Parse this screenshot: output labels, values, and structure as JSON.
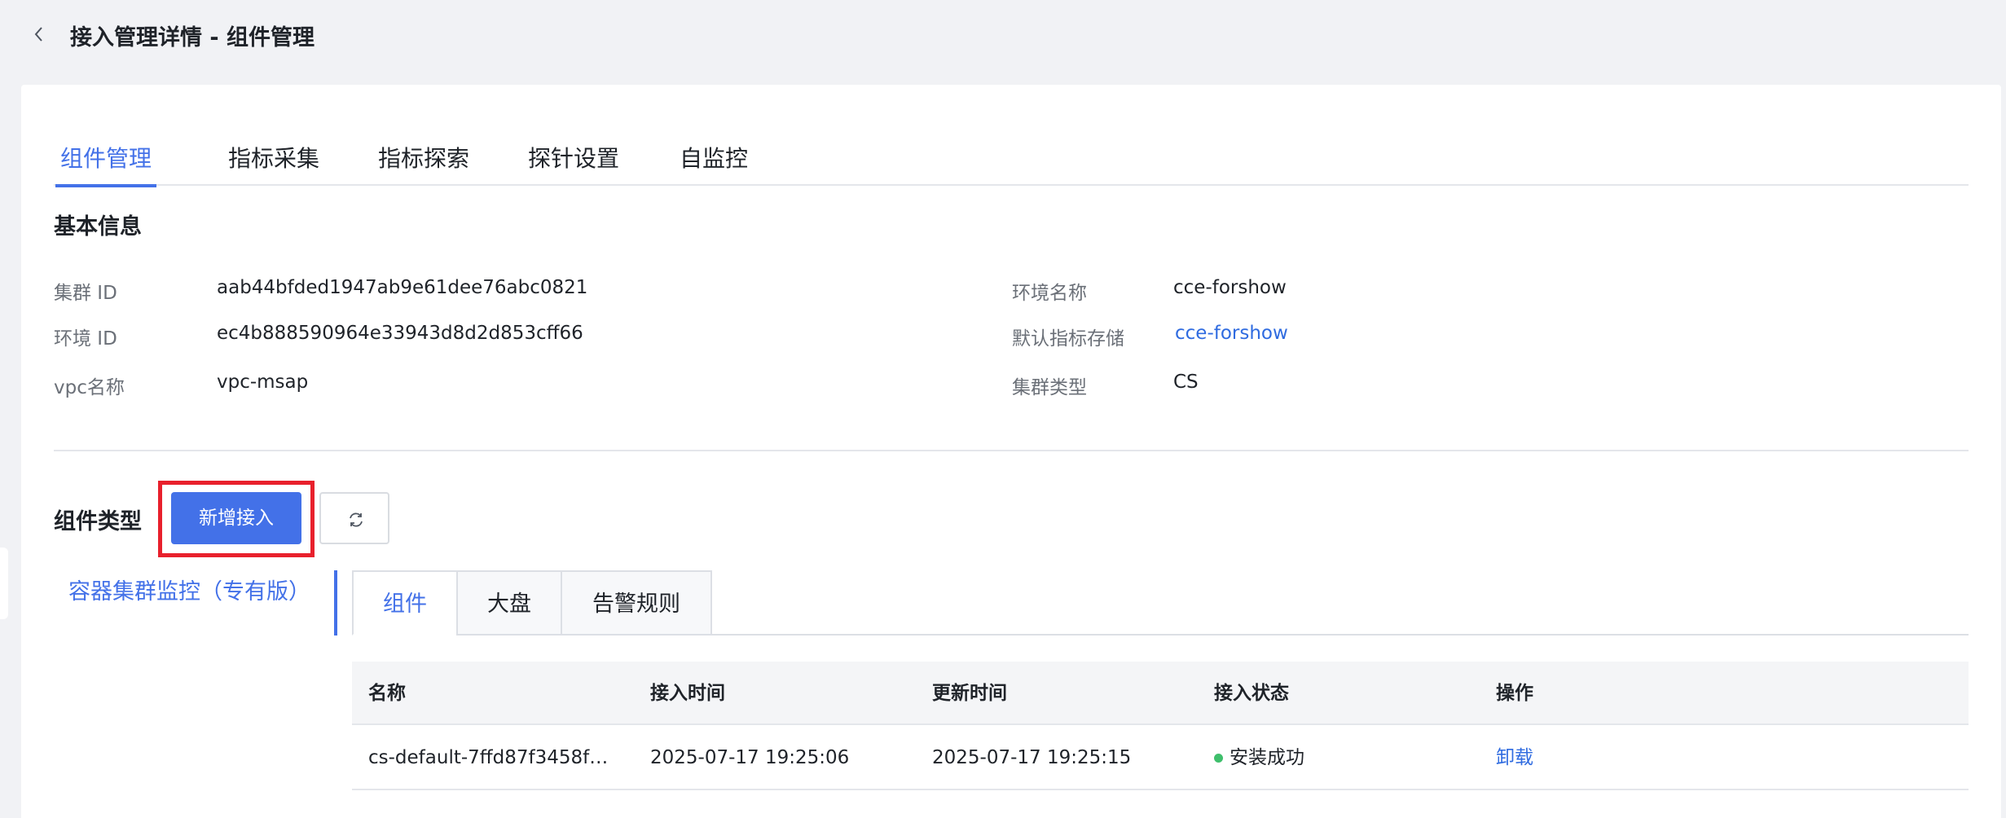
{
  "header": {
    "title": "接入管理详情 - 组件管理"
  },
  "tabs": [
    {
      "label": "组件管理",
      "active": true
    },
    {
      "label": "指标采集",
      "active": false
    },
    {
      "label": "指标探索",
      "active": false
    },
    {
      "label": "探针设置",
      "active": false
    },
    {
      "label": "自监控",
      "active": false
    }
  ],
  "basic_info": {
    "title": "基本信息",
    "cluster_id_label": "集群 ID",
    "cluster_id": "aab44bfded1947ab9e61dee76abc0821",
    "env_id_label": "环境 ID",
    "env_id": "ec4b888590964e33943d8d2d853cff66",
    "vpc_label": "vpc名称",
    "vpc": "vpc-msap",
    "env_name_label": "环境名称",
    "env_name": "cce-forshow",
    "metric_store_label": "默认指标存储",
    "metric_store": "cce-forshow",
    "cluster_type_label": "集群类型",
    "cluster_type": "CS"
  },
  "component": {
    "title": "组件类型",
    "add_button": "新增接入",
    "side_item": "容器集群监控（专有版）",
    "sub_tabs": [
      {
        "label": "组件",
        "active": true
      },
      {
        "label": "大盘",
        "active": false
      },
      {
        "label": "告警规则",
        "active": false
      }
    ],
    "table": {
      "columns": [
        "名称",
        "接入时间",
        "更新时间",
        "接入状态",
        "操作"
      ],
      "rows": [
        {
          "name": "cs-default-7ffd87f3458f4…",
          "access_time": "2025-07-17 19:25:06",
          "update_time": "2025-07-17 19:25:15",
          "status": "安装成功",
          "action": "卸载"
        }
      ]
    }
  },
  "colors": {
    "accent": "#4371e8",
    "link": "#2f6be0",
    "highlight": "#e8202c",
    "success": "#3fbf6c"
  }
}
